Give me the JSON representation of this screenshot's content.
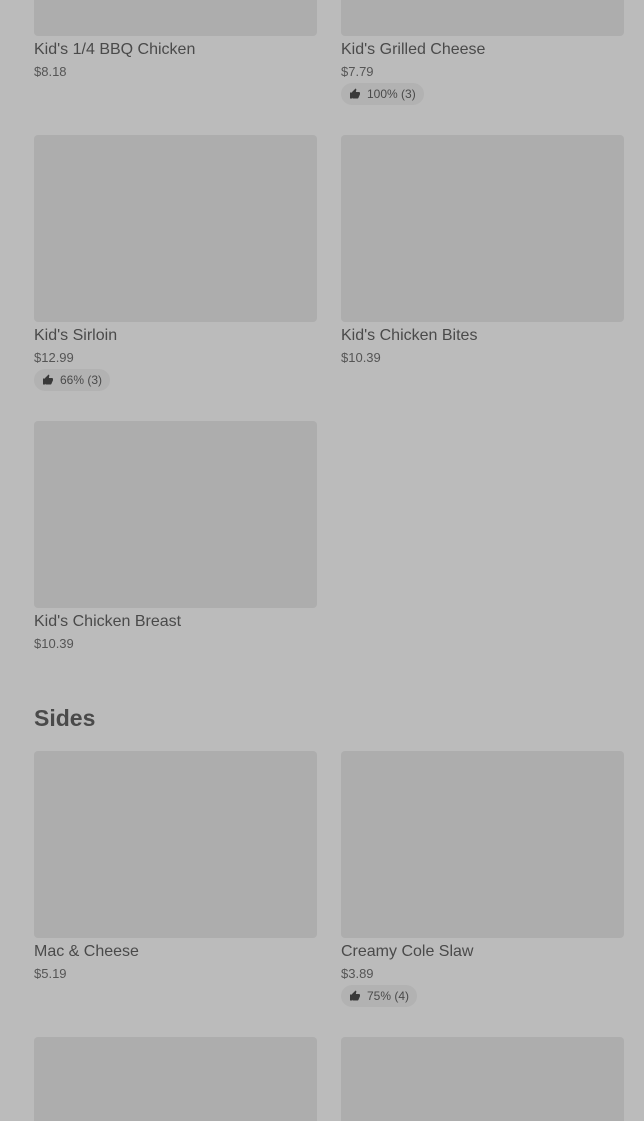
{
  "items": [
    {
      "name": "Kid's 1/4 BBQ Chicken",
      "price": "$8.18"
    },
    {
      "name": "Kid's Grilled Cheese",
      "price": "$7.79",
      "rating": "100% (3)"
    },
    {
      "name": "Kid's Sirloin",
      "price": "$12.99",
      "rating": "66% (3)"
    },
    {
      "name": "Kid's Chicken Bites",
      "price": "$10.39"
    },
    {
      "name": "Kid's Chicken Breast",
      "price": "$10.39"
    }
  ],
  "sides": {
    "title": "Sides",
    "items": [
      {
        "name": "Mac & Cheese",
        "price": "$5.19"
      },
      {
        "name": "Creamy Cole Slaw",
        "price": "$3.89",
        "rating": "75% (4)"
      }
    ]
  },
  "icons": {
    "rating": "thumbs-up-icon"
  },
  "colors": {
    "background": "#bbbbbb",
    "placeholder": "#adadad",
    "text": "#4a4a4a"
  }
}
